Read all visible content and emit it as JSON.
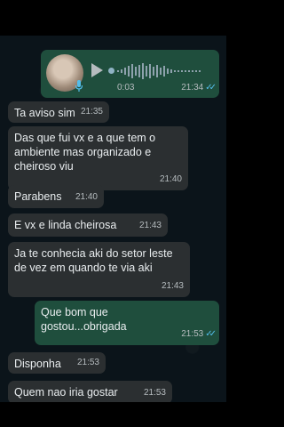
{
  "audio_message": {
    "duration": "0:03",
    "time": "21:34",
    "status": "read",
    "ticks": "✓✓"
  },
  "messages": [
    {
      "direction": "incoming",
      "text": "Ta aviso sim",
      "time": "21:35"
    },
    {
      "direction": "incoming",
      "text": "Das que fui vx e a que tem o ambiente mas organizado e cheiroso viu",
      "time": "21:40"
    },
    {
      "direction": "incoming",
      "text": "Parabens",
      "time": "21:40"
    },
    {
      "direction": "incoming",
      "text": "E vx e linda cheirosa",
      "time": "21:43"
    },
    {
      "direction": "incoming",
      "text": "Ja te conhecia aki do setor leste de vez em quando te via aki",
      "time": "21:43"
    },
    {
      "direction": "outgoing",
      "text": "Que bom que gostou...obrigada",
      "time": "21:53",
      "ticks": "✓✓"
    },
    {
      "direction": "incoming",
      "text": "Disponha",
      "time": "21:53"
    },
    {
      "direction": "incoming",
      "text": "Quem nao iria gostar",
      "time": "21:53"
    }
  ],
  "colors": {
    "background": "#0b141a",
    "incoming_bubble": "#2b2f31",
    "outgoing_bubble": "#1f4e3d",
    "read_ticks": "#53bdeb"
  }
}
